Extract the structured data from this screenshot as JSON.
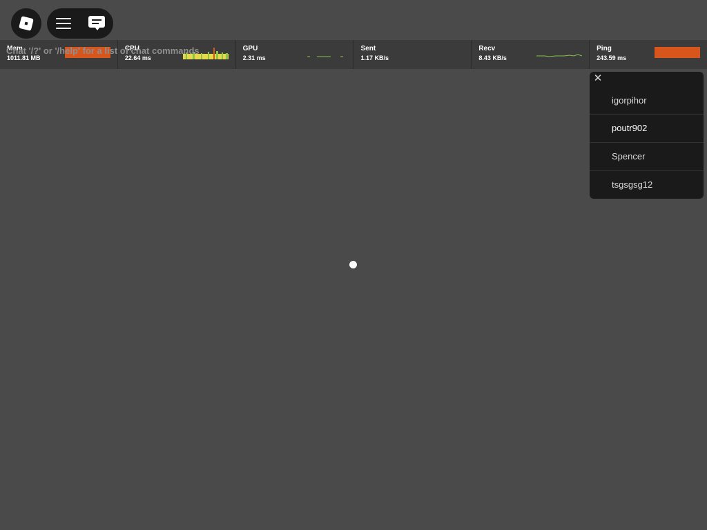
{
  "chat_hint": "Chat '/?' or '/help' for a list of chat commands",
  "top_buttons": {
    "logo_icon": "roblox-logo-icon",
    "menu_icon": "hamburger-menu-icon",
    "chat_icon": "chat-bubble-icon"
  },
  "stats": [
    {
      "label": "Mem",
      "value": "1011.81 MB",
      "graph": "bar"
    },
    {
      "label": "CPU",
      "value": "22.64 ms",
      "graph": "sparkline"
    },
    {
      "label": "GPU",
      "value": "2.31 ms",
      "graph": "sparkline"
    },
    {
      "label": "Sent",
      "value": "1.17 KB/s",
      "graph": "none"
    },
    {
      "label": "Recv",
      "value": "8.43 KB/s",
      "graph": "sparkline"
    },
    {
      "label": "Ping",
      "value": "243.59 ms",
      "graph": "bar"
    }
  ],
  "player_list": {
    "close_icon": "close-icon",
    "players": [
      "igorpihor",
      "poutr902",
      "Spencer",
      "tsgsgsg12"
    ]
  },
  "colors": {
    "background": "#4a4a4a",
    "stats_bar": "#3b3b3b",
    "alert_bar": "#d8561c",
    "graph_green": "#8ac34a",
    "graph_yellow": "#e6d84a"
  }
}
